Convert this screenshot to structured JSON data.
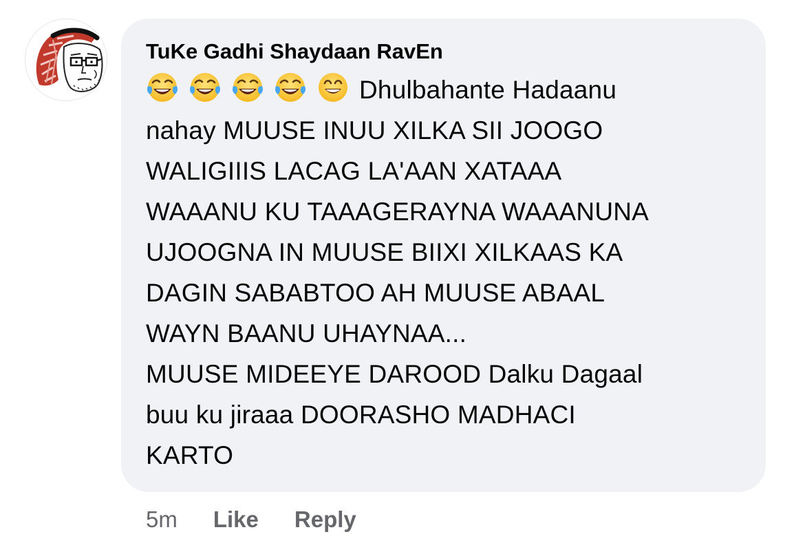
{
  "comment": {
    "author": "TuKe Gadhi Shaydaan RavEn",
    "emojis": [
      "face-with-tears-of-joy-icon",
      "face-with-tears-of-joy-icon",
      "face-with-tears-of-joy-icon",
      "face-with-tears-of-joy-icon",
      "grinning-face-icon"
    ],
    "lines": [
      "Dhulbahante Hadaanu",
      "nahay MUUSE INUU XILKA SII JOOGO",
      "WALIGIIIS LACAG LA'AAN XATAAA",
      "WAAANU KU TAAAGERAYNA WAAANUNA",
      "UJOOGNA IN MUUSE BIIXI XILKAAS KA",
      "DAGIN SABABTOO AH MUUSE ABAAL",
      "WAYN BAANU UHAYNAA...",
      "MUUSE MIDEEYE DAROOD Dalku Dagaal",
      "buu ku jiraaa DOORASHO MADHACI",
      "KARTO"
    ],
    "time": "5m",
    "like_label": "Like",
    "reply_label": "Reply"
  },
  "colors": {
    "bubble": "#f0f2f5",
    "text": "#050505",
    "meta": "#65676b"
  }
}
